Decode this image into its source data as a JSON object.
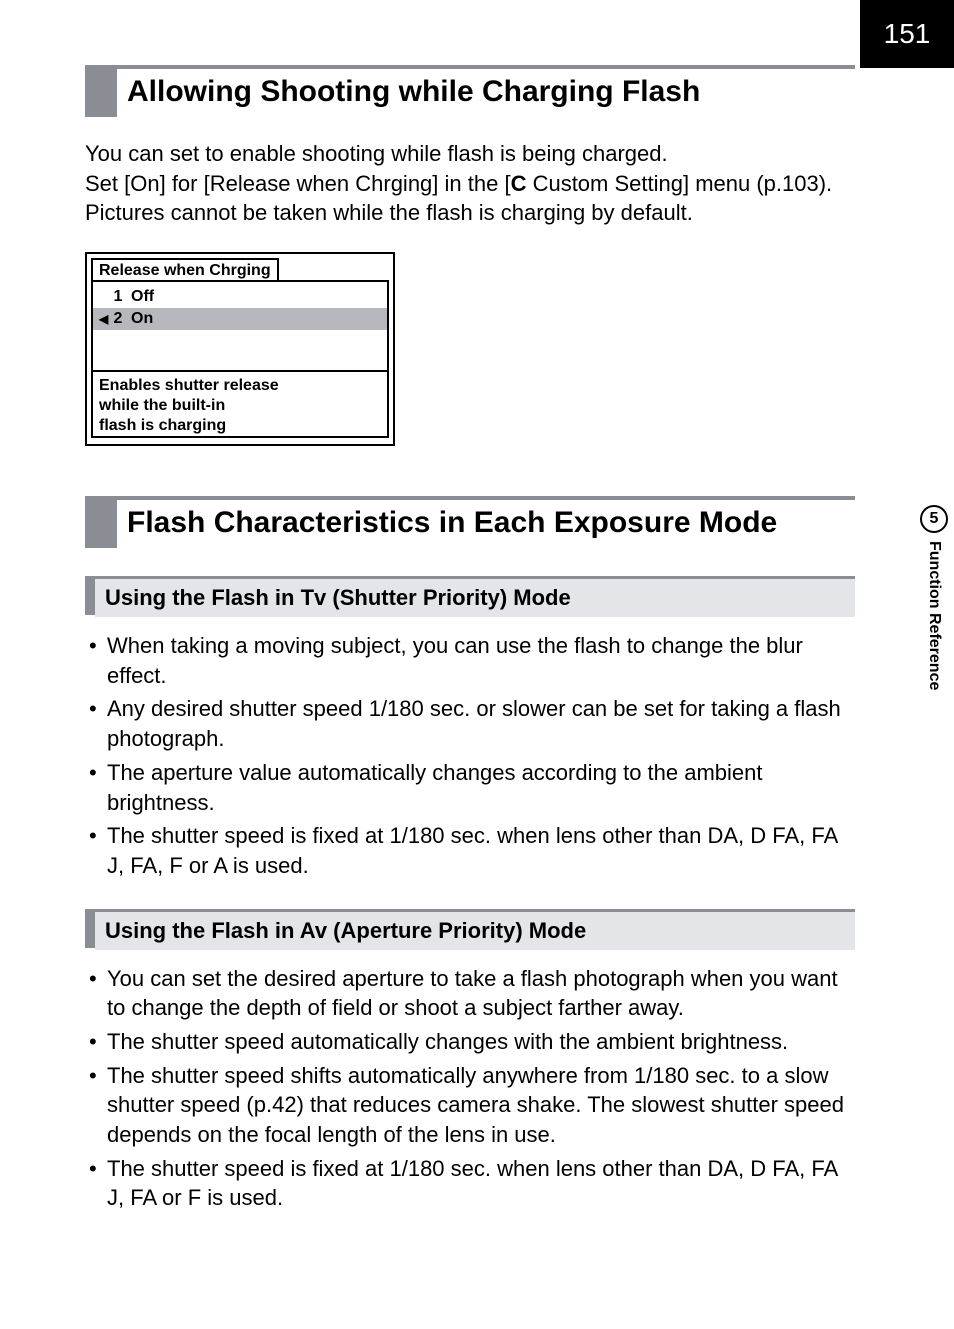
{
  "pageNumber": "151",
  "sideTab": {
    "number": "5",
    "label": "Function Reference"
  },
  "h1_1": "Allowing Shooting while Charging Flash",
  "para1_line1": "You can set to enable shooting while flash is being charged.",
  "para1_line2a": "Set [On] for [Release when Chrging] in the [",
  "para1_line2_icon": "C",
  "para1_line2b": " Custom Setting] menu (p.103). Pictures cannot be taken while the flash is charging by default.",
  "menu": {
    "title": "Release when Chrging",
    "opt1": {
      "num": "1",
      "label": "Off"
    },
    "opt2": {
      "marker": "◀",
      "num": "2",
      "label": "On"
    },
    "desc_l1": "Enables shutter release",
    "desc_l2": "while the built-in",
    "desc_l3": "flash is charging"
  },
  "h1_2": "Flash Characteristics in Each Exposure Mode",
  "h2_1a": "Using the Flash in ",
  "h2_1_icon": "Tv",
  "h2_1b": " (Shutter Priority) Mode",
  "tv_bullets": {
    "b1": "When taking a moving subject, you can use the flash to change the blur effect.",
    "b2": "Any desired shutter speed 1/180 sec. or slower can be set for taking a flash photograph.",
    "b3": "The aperture value automatically changes according to the ambient brightness.",
    "b4": "The shutter speed is fixed at 1/180 sec. when lens other than DA, D FA, FA J, FA, F or A is used."
  },
  "h2_2": "Using the Flash in Av (Aperture Priority) Mode",
  "av_bullets": {
    "b1": "You can set the desired aperture to take a flash photograph when you want to change the depth of field or shoot a subject farther away.",
    "b2": "The shutter speed automatically changes with the ambient brightness.",
    "b3": "The shutter speed shifts automatically anywhere from 1/180 sec. to a slow shutter speed (p.42) that reduces camera shake. The slowest shutter speed depends on the focal length of the lens in use.",
    "b4": "The shutter speed is fixed at 1/180 sec. when lens other than DA, D FA, FA J, FA or F is used."
  }
}
